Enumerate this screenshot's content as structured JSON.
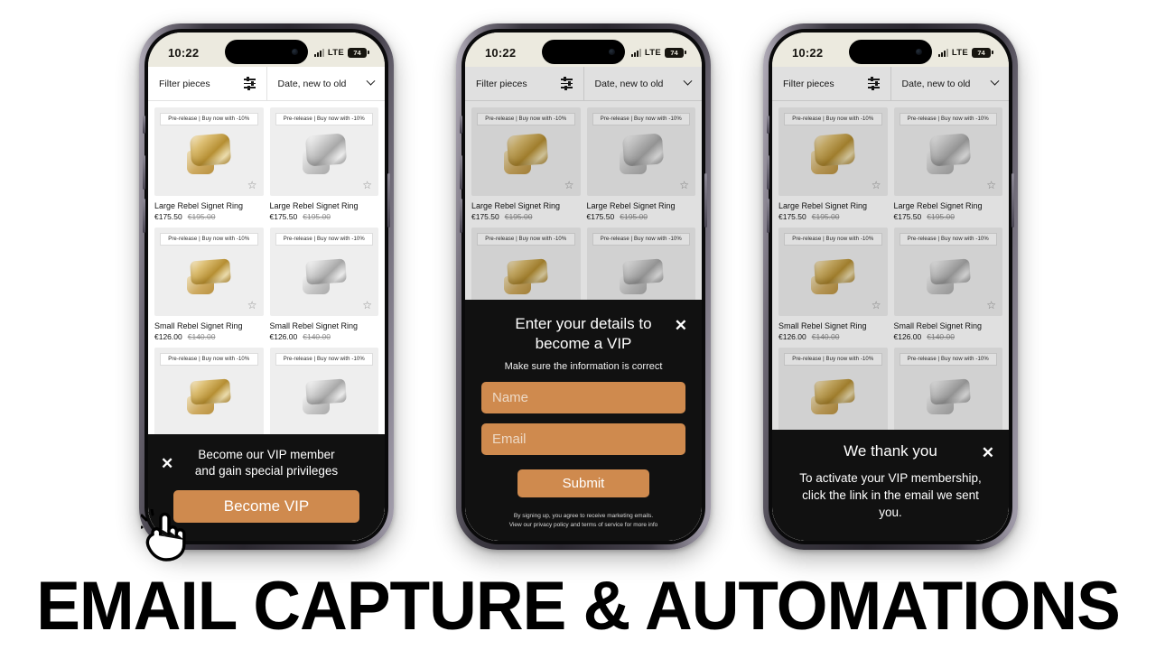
{
  "headline": "EMAIL CAPTURE & AUTOMATIONS",
  "status_bar": {
    "time": "10:22",
    "network": "LTE",
    "battery": "74",
    "signal_icon": "signal-bars-icon",
    "battery_icon": "battery-icon"
  },
  "filter_bar": {
    "filter_label": "Filter pieces",
    "filter_icon": "sliders-icon",
    "sort_label": "Date, new to old",
    "sort_icon": "chevron-down-icon"
  },
  "products": [
    {
      "badge": "Pre-release | Buy now with -10%",
      "name": "Large Rebel Signet Ring",
      "price": "€175.50",
      "compare_at": "€195.00",
      "metal": "gold",
      "size": "large"
    },
    {
      "badge": "Pre-release | Buy now with -10%",
      "name": "Large Rebel Signet Ring",
      "price": "€175.50",
      "compare_at": "€195.00",
      "metal": "silver",
      "size": "large"
    },
    {
      "badge": "Pre-release | Buy now with -10%",
      "name": "Small Rebel Signet Ring",
      "price": "€126.00",
      "compare_at": "€140.00",
      "metal": "gold",
      "size": "small"
    },
    {
      "badge": "Pre-release | Buy now with -10%",
      "name": "Small Rebel Signet Ring",
      "price": "€126.00",
      "compare_at": "€140.00",
      "metal": "silver",
      "size": "small"
    },
    {
      "badge": "Pre-release | Buy now with -10%",
      "name": "",
      "price": "",
      "compare_at": "",
      "metal": "gold",
      "size": "small"
    },
    {
      "badge": "Pre-release | Buy now with -10%",
      "name": "",
      "price": "",
      "compare_at": "",
      "metal": "silver",
      "size": "small"
    }
  ],
  "wishlist_icon": "star-outline-icon",
  "banner": {
    "line1": "Become our VIP member",
    "line2": "and gain special privileges",
    "cta_label": "Become VIP",
    "close_icon": "✕"
  },
  "modal": {
    "title": "Enter your details to become a VIP",
    "subtitle": "Make sure the information is correct",
    "name_placeholder": "Name",
    "name_value": "",
    "email_placeholder": "Email",
    "email_value": "",
    "submit_label": "Submit",
    "fineprint_line1": "By signing up, you agree to receive marketing emails.",
    "fineprint_line2": "View our privacy policy and terms of service for more info",
    "close_icon": "✕"
  },
  "thanks": {
    "title": "We thank you",
    "body": "To activate your VIP membership, click the link in the email we sent you.",
    "close_icon": "✕"
  },
  "colors": {
    "accent": "#cf8a4e",
    "panel_bg": "#111111",
    "screen_bg": "#eceadf",
    "headline": "#000000"
  },
  "cursor_icon": "tap-hand-icon"
}
